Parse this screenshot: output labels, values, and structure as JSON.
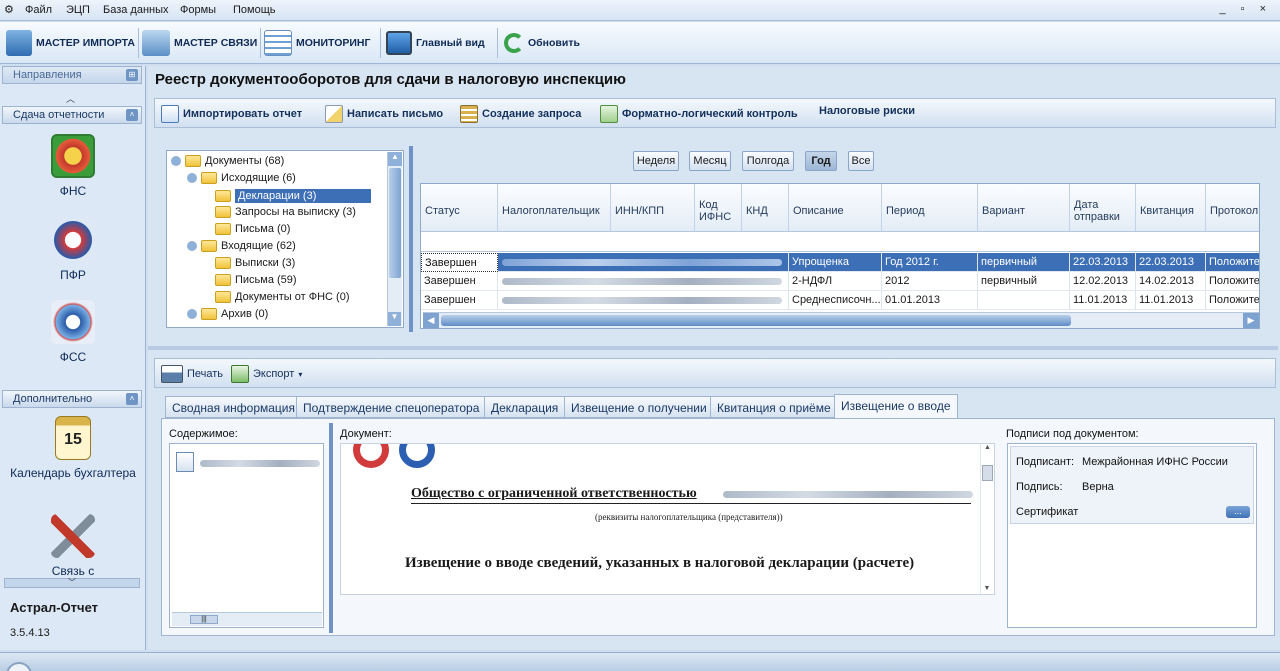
{
  "menu": [
    "Файл",
    "ЭЦП",
    "База данных",
    "Формы",
    "Помощь"
  ],
  "window_controls": "_ ▫ ×",
  "toolbar": {
    "import_master": "МАСТЕР ИМПОРТА",
    "link_master": "МАСТЕР СВЯЗИ",
    "monitoring": "МОНИТОРИНГ",
    "main_view": "Главный вид",
    "refresh": "Обновить"
  },
  "sidebar": {
    "header": "Направления",
    "section1": "Сдача отчетности",
    "items": [
      {
        "label": "ФНС",
        "icon": "fns-icon"
      },
      {
        "label": "ПФР",
        "icon": "pfr-icon"
      },
      {
        "label": "ФСС",
        "icon": "fss-icon"
      }
    ],
    "section2": "Дополнительно",
    "extra": [
      {
        "label": "Календарь бухгалтера",
        "icon": "calendar-icon",
        "day": "15"
      },
      {
        "label": "Связь с",
        "icon": "tools-icon"
      }
    ],
    "app_name": "Астрал-Отчет",
    "version": "3.5.4.13"
  },
  "page_title": "Реестр документооборотов для сдачи в налоговую инспекцию",
  "actions": {
    "import": "Импортировать отчет",
    "write": "Написать письмо",
    "request": "Создание запроса",
    "flk": "Форматно-логический контроль",
    "risks": "Налоговые риски"
  },
  "tree": [
    {
      "label": "Документы (68)",
      "level": 0
    },
    {
      "label": "Исходящие (6)",
      "level": 1
    },
    {
      "label": "Декларации (3)",
      "level": 2,
      "selected": true
    },
    {
      "label": "Запросы на выписку (3)",
      "level": 2
    },
    {
      "label": "Письма (0)",
      "level": 2
    },
    {
      "label": "Входящие (62)",
      "level": 1
    },
    {
      "label": "Выписки (3)",
      "level": 2
    },
    {
      "label": "Письма (59)",
      "level": 2
    },
    {
      "label": "Документы от ФНС (0)",
      "level": 2
    },
    {
      "label": "Архив (0)",
      "level": 1
    }
  ],
  "periods": {
    "week": "Неделя",
    "month": "Месяц",
    "half": "Полгода",
    "year": "Год",
    "all": "Все",
    "selected": "Год"
  },
  "grid": {
    "columns": [
      "Статус",
      "Налогоплательщик",
      "ИНН/КПП",
      "Код ИФНС",
      "КНД",
      "Описание",
      "Период",
      "Вариант",
      "Дата отправки",
      "Квитанция",
      "Протокол"
    ],
    "rows": [
      [
        "Завершен",
        "",
        "",
        "",
        "",
        "Упрощенка",
        "Год 2012 г.",
        "первичный",
        "22.03.2013",
        "22.03.2013",
        "Положител"
      ],
      [
        "Завершен",
        "",
        "",
        "",
        "",
        "2-НДФЛ",
        "2012",
        "первичный",
        "12.02.2013",
        "14.02.2013",
        "Положител"
      ],
      [
        "Завершен",
        "",
        "",
        "",
        "",
        "Среднесписочн...",
        "01.01.2013",
        "",
        "11.01.2013",
        "11.01.2013",
        "Положител"
      ]
    ]
  },
  "bottom_toolbar": {
    "print": "Печать",
    "export": "Экспорт"
  },
  "tabs": [
    "Сводная информация",
    "Подтверждение спецоператора",
    "Декларация",
    "Извещение о получении",
    "Квитанция о приёме",
    "Извещение о вводе"
  ],
  "active_tab": "Извещение о вводе",
  "contents_label": "Содержимое:",
  "document_label": "Документ:",
  "document": {
    "org": "Общество с ограниченной ответственностью",
    "org_note": "(реквизиты налогоплательщика (представителя))",
    "heading": "Извещение о вводе сведений, указанных в налоговой декларации (расчете)"
  },
  "signatures": {
    "label": "Подписи под документом:",
    "signer_label": "Подписант:",
    "signer_value": "Межрайонная ИФНС России",
    "sign_label": "Подпись:",
    "sign_value": "Верна",
    "cert_label": "Сертификат",
    "cert_button": "..."
  },
  "colors": {
    "accent": "#3d6fb6",
    "panel": "#d7e4f2"
  }
}
